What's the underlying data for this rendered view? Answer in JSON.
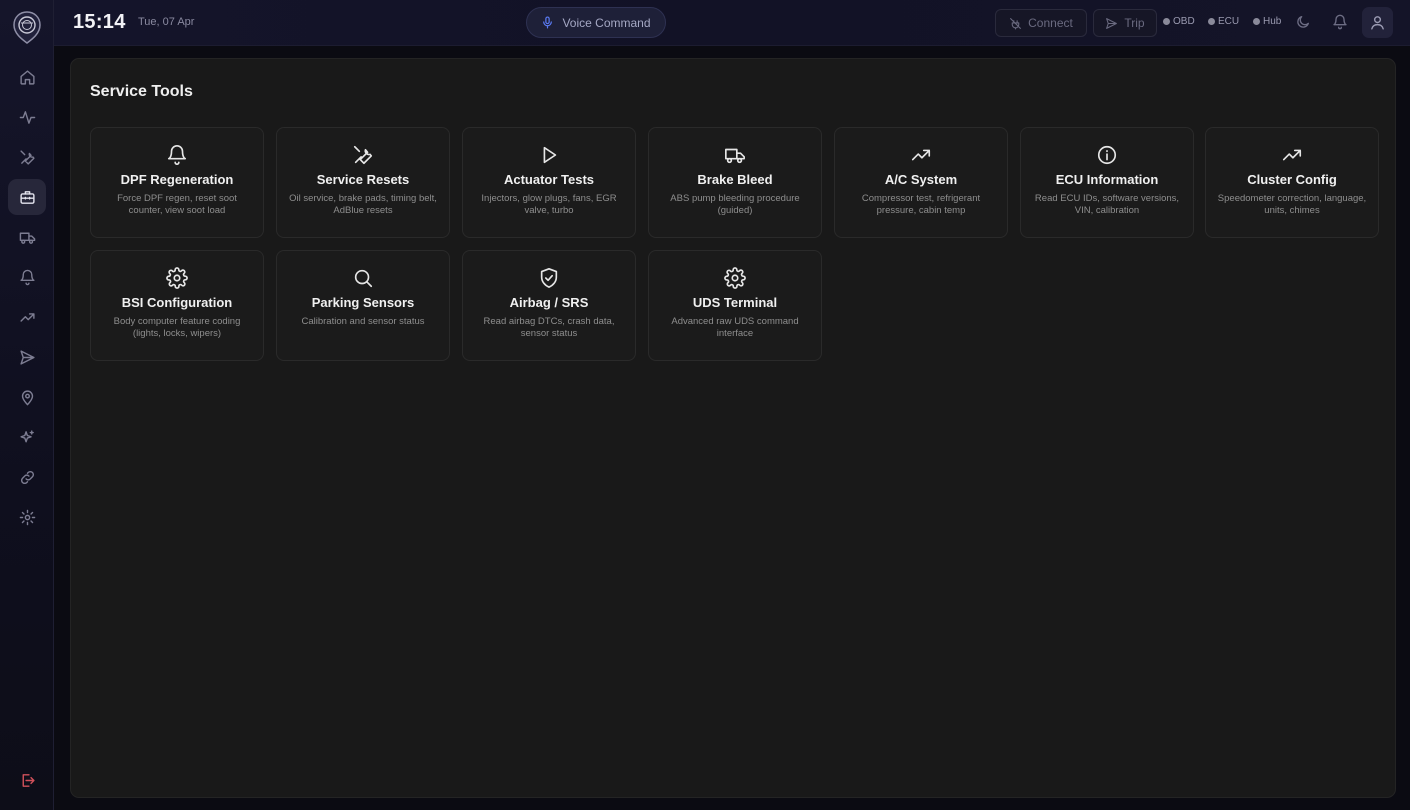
{
  "topbar": {
    "time": "15:14",
    "date": "Tue, 07 Apr",
    "voice_label": "Voice Command",
    "connect_label": "Connect",
    "trip_label": "Trip",
    "status": [
      {
        "label": "OBD",
        "icon": "status-dot-gray"
      },
      {
        "label": "ECU",
        "icon": "status-dot-gray"
      },
      {
        "label": "Hub",
        "icon": "status-dot-gray"
      }
    ]
  },
  "sidebar": {
    "items": [
      {
        "name": "home",
        "icon": "home-icon"
      },
      {
        "name": "live-data",
        "icon": "activity-icon"
      },
      {
        "name": "diagnostics",
        "icon": "tools-icon"
      },
      {
        "name": "service-tools",
        "icon": "toolbox-icon",
        "active": true
      },
      {
        "name": "vehicle",
        "icon": "truck-icon"
      },
      {
        "name": "alerts",
        "icon": "bell-icon"
      },
      {
        "name": "trends",
        "icon": "trending-up-icon"
      },
      {
        "name": "send",
        "icon": "send-icon"
      },
      {
        "name": "location",
        "icon": "map-pin-icon"
      },
      {
        "name": "ai",
        "icon": "sparkles-icon"
      },
      {
        "name": "links",
        "icon": "link-icon"
      },
      {
        "name": "settings",
        "icon": "gear-icon"
      }
    ]
  },
  "main": {
    "title": "Service Tools",
    "cards": [
      {
        "title": "DPF Regeneration",
        "desc": "Force DPF regen, reset soot counter, view soot load",
        "icon": "bell-icon"
      },
      {
        "title": "Service Resets",
        "desc": "Oil service, brake pads, timing belt, AdBlue resets",
        "icon": "wrench-icon"
      },
      {
        "title": "Actuator Tests",
        "desc": "Injectors, glow plugs, fans, EGR valve, turbo",
        "icon": "play-icon"
      },
      {
        "title": "Brake Bleed",
        "desc": "ABS pump bleeding procedure (guided)",
        "icon": "truck-icon"
      },
      {
        "title": "A/C System",
        "desc": "Compressor test, refrigerant pressure, cabin temp",
        "icon": "trending-up-icon"
      },
      {
        "title": "ECU Information",
        "desc": "Read ECU IDs, software versions, VIN, calibration",
        "icon": "info-icon"
      },
      {
        "title": "Cluster Config",
        "desc": "Speedometer correction, language, units, chimes",
        "icon": "trending-up-icon"
      },
      {
        "title": "BSI Configuration",
        "desc": "Body computer feature coding (lights, locks, wipers)",
        "icon": "gear-icon"
      },
      {
        "title": "Parking Sensors",
        "desc": "Calibration and sensor status",
        "icon": "search-icon"
      },
      {
        "title": "Airbag / SRS",
        "desc": "Read airbag DTCs, crash data, sensor status",
        "icon": "shield-check-icon"
      },
      {
        "title": "UDS Terminal",
        "desc": "Advanced raw UDS command interface",
        "icon": "gear-icon"
      }
    ]
  }
}
